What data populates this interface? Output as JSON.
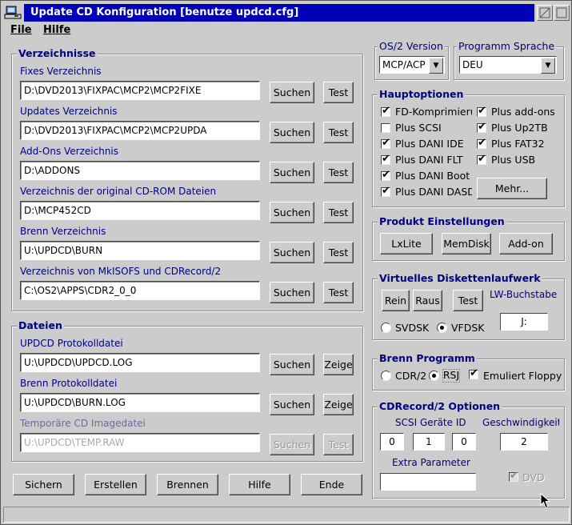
{
  "window": {
    "title": "Update CD Konfiguration [benutze updcd.cfg]"
  },
  "menu": {
    "file": "File",
    "help": "Hilfe"
  },
  "dirs": {
    "title": "Verzeichnisse",
    "rows": [
      {
        "label": "Fixes Verzeichnis",
        "value": "D:\\DVD2013\\FIXPAC\\MCP2\\MCP2FIXE"
      },
      {
        "label": "Updates Verzeichnis",
        "value": "D:\\DVD2013\\FIXPAC\\MCP2\\MCP2UPDA"
      },
      {
        "label": "Add-Ons Verzeichnis",
        "value": "D:\\ADDONS"
      },
      {
        "label": "Verzeichnis der original CD-ROM Dateien",
        "value": "D:\\MCP452CD"
      },
      {
        "label": "Brenn Verzeichnis",
        "value": "U:\\UPDCD\\BURN"
      },
      {
        "label": "Verzeichnis von MkISOFS und CDRecord/2",
        "value": "C:\\OS2\\APPS\\CDR2_0_0"
      }
    ],
    "search": "Suchen",
    "test": "Test"
  },
  "files": {
    "title": "Dateien",
    "rows": [
      {
        "label": "UPDCD Protokolldatei",
        "value": "U:\\UPDCD\\UPDCD.LOG",
        "btn1": "Suchen",
        "btn2": "Zeige"
      },
      {
        "label": "Brenn Protokolldatei",
        "value": "U:\\UPDCD\\BURN.LOG",
        "btn1": "Suchen",
        "btn2": "Zeige"
      },
      {
        "label": "Temporäre CD Imagedatei",
        "value": "U:\\UPDCD\\TEMP.RAW",
        "btn1": "Suchen",
        "btn2": "Test"
      }
    ]
  },
  "bottom_buttons": [
    "Sichern",
    "Erstellen",
    "Brennen",
    "Hilfe",
    "Ende"
  ],
  "os2": {
    "title": "OS/2 Version",
    "value": "MCP/ACP"
  },
  "lang": {
    "title": "Programm Sprache",
    "value": "DEU"
  },
  "main_options": {
    "title": "Hauptoptionen",
    "left": [
      {
        "label": "FD-Komprimierun",
        "checked": true
      },
      {
        "label": "Plus SCSI",
        "checked": false
      },
      {
        "label": "Plus DANI IDE",
        "checked": true
      },
      {
        "label": "Plus DANI FLT",
        "checked": true
      },
      {
        "label": "Plus DANI Boot",
        "checked": true
      },
      {
        "label": "Plus DANI DASD",
        "checked": true
      }
    ],
    "right": [
      {
        "label": "Plus add-ons",
        "checked": true
      },
      {
        "label": "Plus Up2TB",
        "checked": true
      },
      {
        "label": "Plus FAT32",
        "checked": true
      },
      {
        "label": "Plus USB",
        "checked": true
      }
    ],
    "more": "Mehr..."
  },
  "product": {
    "title": "Produkt Einstellungen",
    "buttons": [
      "LxLite",
      "MemDisk",
      "Add-on"
    ]
  },
  "vdisk": {
    "title": "Virtuelles Diskettenlaufwerk",
    "buttons": [
      "Rein",
      "Raus",
      "Test"
    ],
    "drive_label": "LW-Buchstabe",
    "drive_value": "J:",
    "radio1": "SVDSK",
    "radio2": "VFDSK"
  },
  "burn": {
    "title": "Brenn Programm",
    "radio1": "CDR/2",
    "radio2": "RSJ",
    "check": "Emuliert Floppy"
  },
  "cdrecord": {
    "title": "CDRecord/2 Optionen",
    "scsi_label": "SCSI Geräte ID",
    "scsi": [
      "0",
      "1",
      "0"
    ],
    "speed_label": "Geschwindigkeit",
    "speed": "2",
    "extra_label": "Extra Parameter",
    "extra": "",
    "dvd": "DVD"
  }
}
